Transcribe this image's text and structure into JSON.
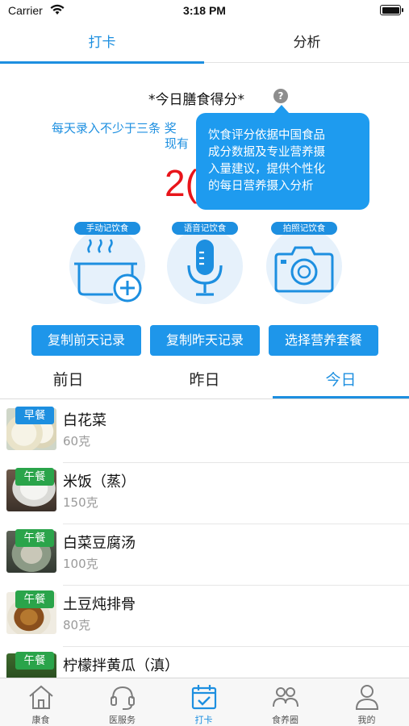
{
  "status_bar": {
    "carrier": "Carrier",
    "time": "3:18 PM"
  },
  "top_tabs": [
    {
      "label": "打卡",
      "active": true
    },
    {
      "label": "分析",
      "active": false
    }
  ],
  "score": {
    "title": "*今日膳食得分*",
    "help_icon": "?",
    "hint_line1": "每天录入不少于三条 奖",
    "hint_line2": "现有",
    "value_partial": "2(",
    "tooltip_lines": [
      "饮食评分依据中国食品",
      "成分数据及专业营养摄",
      "入量建议，提供个性化",
      "的每日营养摄入分析"
    ]
  },
  "methods": [
    {
      "label": "手动记饮食",
      "icon": "pot-plus-icon"
    },
    {
      "label": "语音记饮食",
      "icon": "microphone-icon"
    },
    {
      "label": "拍照记饮食",
      "icon": "camera-icon"
    }
  ],
  "buttons": [
    "复制前天记录",
    "复制昨天记录",
    "选择营养套餐"
  ],
  "day_tabs": [
    {
      "label": "前日",
      "active": false
    },
    {
      "label": "昨日",
      "active": false
    },
    {
      "label": "今日",
      "active": true
    }
  ],
  "foods": [
    {
      "meal": "早餐",
      "meal_color": "#1d8fe0",
      "name": "白花菜",
      "amount": "60克"
    },
    {
      "meal": "午餐",
      "meal_color": "#2aa44a",
      "name": "米饭（蒸）",
      "amount": "150克"
    },
    {
      "meal": "午餐",
      "meal_color": "#2aa44a",
      "name": "白菜豆腐汤",
      "amount": "100克"
    },
    {
      "meal": "午餐",
      "meal_color": "#2aa44a",
      "name": "土豆炖排骨",
      "amount": "80克"
    },
    {
      "meal": "午餐",
      "meal_color": "#2aa44a",
      "name": "柠檬拌黄瓜（滇）",
      "amount": ""
    }
  ],
  "bottom_nav": [
    {
      "label": "康食",
      "icon": "house-icon",
      "active": false
    },
    {
      "label": "医服务",
      "icon": "headset-icon",
      "active": false
    },
    {
      "label": "打卡",
      "icon": "calendar-check-icon",
      "active": true
    },
    {
      "label": "食养圈",
      "icon": "people-icon",
      "active": false
    },
    {
      "label": "我的",
      "icon": "person-icon",
      "active": false
    }
  ],
  "colors": {
    "accent": "#1d8fe0",
    "score_red": "#e8141a",
    "breakfast": "#1d8fe0",
    "lunch": "#2aa44a"
  }
}
